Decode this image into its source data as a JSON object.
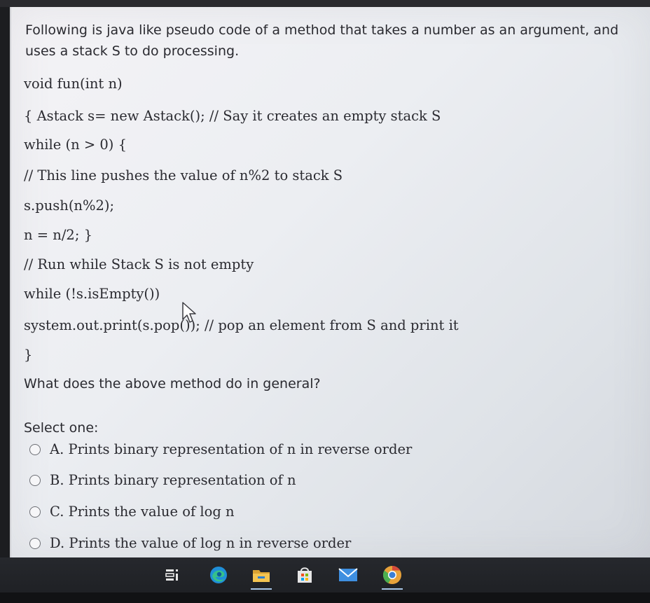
{
  "question": {
    "intro": "Following is java like pseudo code of a method that takes a number as an argument, and uses a stack S to do processing.",
    "code_lines": [
      "void fun(int n)",
      "{ Astack s= new Astack(); // Say it creates an empty stack S",
      "while (n > 0) {",
      "// This line pushes the value of n%2 to stack S",
      "s.push(n%2);",
      "n = n/2; }",
      "// Run while Stack S is not empty",
      "while (!s.isEmpty())",
      "system.out.print(s.pop()); // pop an element from S and print it",
      "}"
    ],
    "prompt": "What does the above method do in general?",
    "select_label": "Select one:",
    "options": [
      "A. Prints binary representation of n in reverse order",
      "B. Prints binary representation of n",
      "C. Prints the value of log n",
      "D. Prints the value of log n in reverse order"
    ]
  },
  "taskbar": {
    "icons": [
      "task-view-icon",
      "edge-browser-icon",
      "file-explorer-icon",
      "store-icon",
      "mail-icon",
      "chrome-icon"
    ],
    "colors": {
      "edge": "#1f8fd8",
      "explorer": "#e8b84a",
      "mail": "#3f8fe0",
      "chrome_ring": "#e8a23a"
    }
  }
}
